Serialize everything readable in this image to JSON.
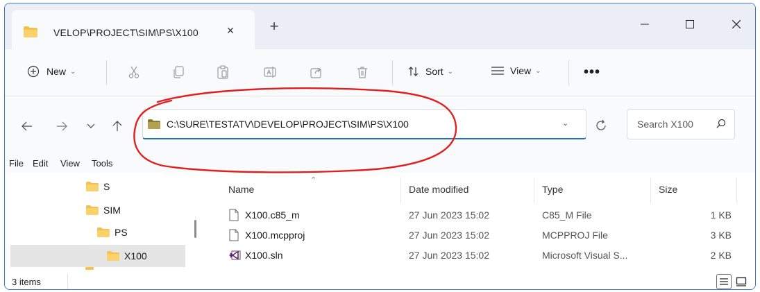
{
  "tab": {
    "title": "VELOP\\PROJECT\\SIM\\PS\\X100",
    "close_icon": "×",
    "new_tab_icon": "+"
  },
  "toolbar": {
    "new_label": "New",
    "sort_label": "Sort",
    "view_label": "View",
    "more_label": "•••"
  },
  "address": {
    "path": "C:\\SURE\\TESTATV\\DEVELOP\\PROJECT\\SIM\\PS\\X100",
    "search_placeholder": "Search X100"
  },
  "menu": [
    "File",
    "Edit",
    "View",
    "Tools"
  ],
  "nav_tree": [
    {
      "label": "S"
    },
    {
      "label": "SIM"
    },
    {
      "label": "PS"
    },
    {
      "label": "X100"
    }
  ],
  "columns": {
    "name": "Name",
    "date": "Date modified",
    "type": "Type",
    "size": "Size"
  },
  "files": [
    {
      "name": "X100.c85_m",
      "date": "27 Jun 2023 15:02",
      "type": "C85_M File",
      "size": "1 KB",
      "icon": "file-icon"
    },
    {
      "name": "X100.mcpproj",
      "date": "27 Jun 2023 15:02",
      "type": "MCPPROJ File",
      "size": "3 KB",
      "icon": "file-icon"
    },
    {
      "name": "X100.sln",
      "date": "27 Jun 2023 15:02",
      "type": "Microsoft Visual S...",
      "size": "2 KB",
      "icon": "visual-studio-solution-icon"
    }
  ],
  "status": {
    "item_count": "3 items"
  },
  "colors": {
    "accent": "#1f6fc5",
    "folder": "#f2c14e",
    "annotation": "#e02020"
  }
}
